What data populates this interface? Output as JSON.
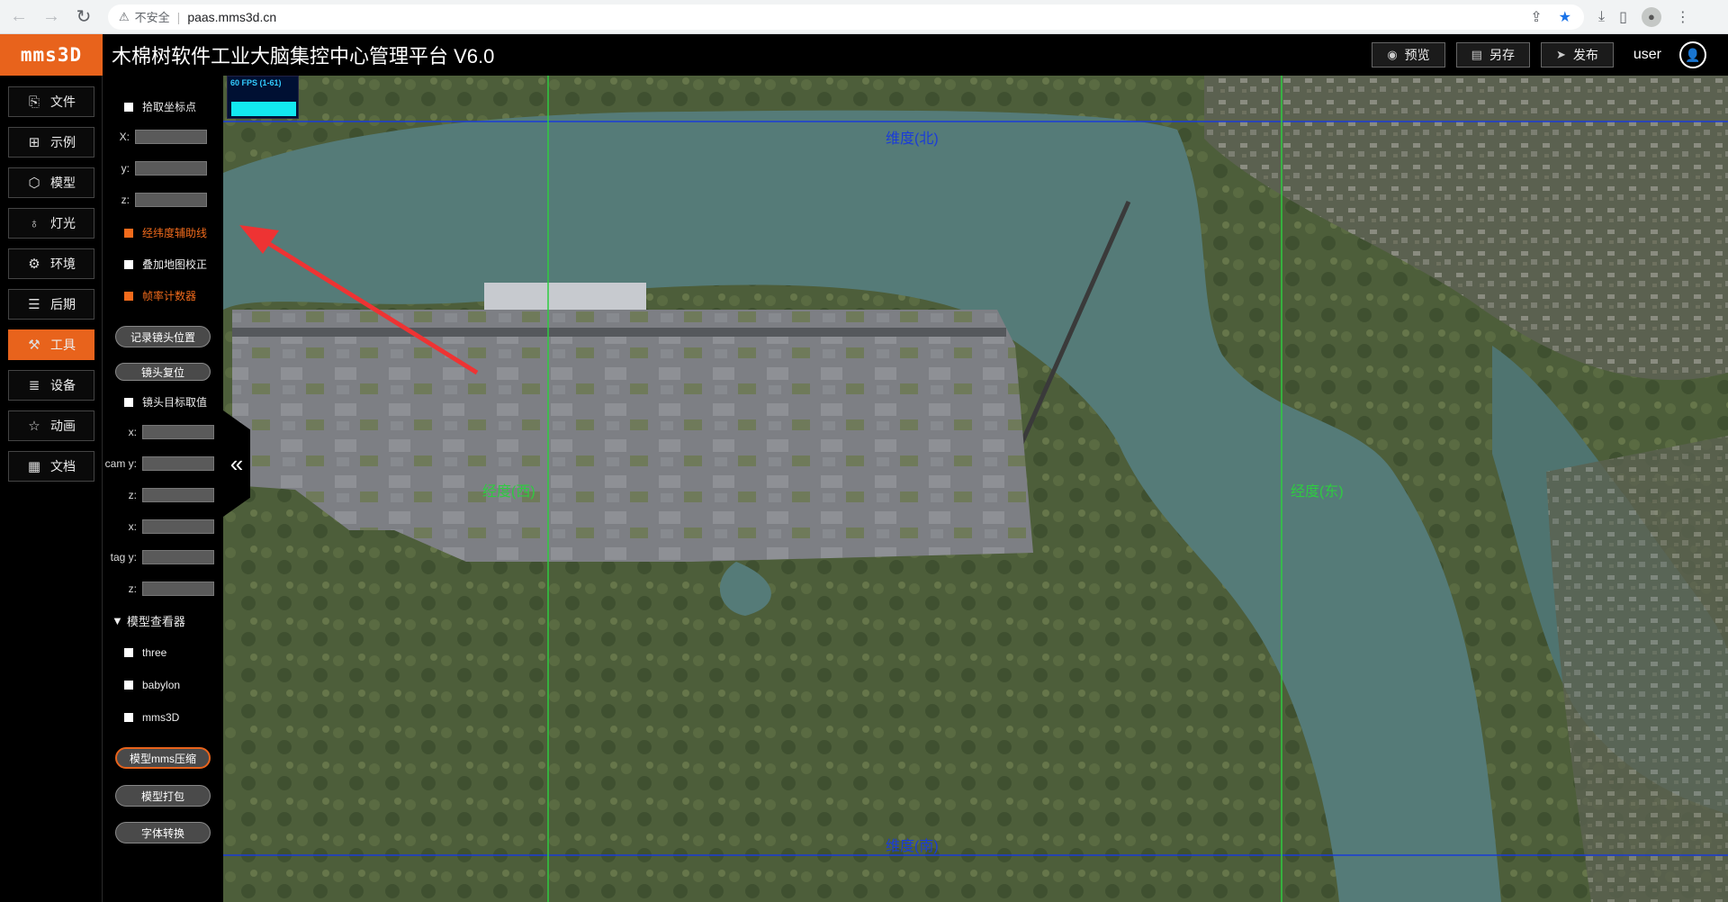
{
  "browser": {
    "security_label": "不安全",
    "url": "paas.mms3d.cn"
  },
  "header": {
    "logo": "mms3D",
    "title": "木棉树软件工业大脑集控中心管理平台 V6.0",
    "actions": [
      {
        "label": "预览",
        "icon": "eye-icon"
      },
      {
        "label": "另存",
        "icon": "save-icon"
      },
      {
        "label": "发布",
        "icon": "send-icon"
      }
    ],
    "user": "user"
  },
  "nav": {
    "items": [
      {
        "label": "文件",
        "icon": "folder-icon"
      },
      {
        "label": "示例",
        "icon": "grid-icon"
      },
      {
        "label": "模型",
        "icon": "cube-icon"
      },
      {
        "label": "灯光",
        "icon": "bulb-icon"
      },
      {
        "label": "环境",
        "icon": "gear-icon"
      },
      {
        "label": "后期",
        "icon": "layers-icon"
      },
      {
        "label": "工具",
        "icon": "wrench-icon",
        "active": true
      },
      {
        "label": "设备",
        "icon": "list-icon"
      },
      {
        "label": "动画",
        "icon": "star-icon"
      },
      {
        "label": "文档",
        "icon": "document-icon"
      }
    ]
  },
  "tools": {
    "pick_point": "拾取坐标点",
    "x_label": "X:",
    "y_label": "y:",
    "z_label": "z:",
    "latlng_guide": "经纬度辅助线",
    "map_overlay": "叠加地图校正",
    "fps_counter": "帧率计数器",
    "record_camera": "记录镜头位置",
    "reset_camera": "镜头复位",
    "camera_target": "镜头目标取值",
    "cam_x": "x:",
    "cam_y": "cam y:",
    "cam_z": "z:",
    "tag_x": "x:",
    "tag_y": "tag  y:",
    "tag_z": "z:",
    "viewer_title": "模型查看器",
    "viewer_three": "three",
    "viewer_babylon": "babylon",
    "viewer_mms3d": "mms3D",
    "compress": "模型mms压缩",
    "pack": "模型打包",
    "font_convert": "字体转换"
  },
  "viewport": {
    "fps_text": "60 FPS (1-61)",
    "lat_north": "维度(北)",
    "lat_south": "维度(南)",
    "lng_west": "经度(西)",
    "lng_east": "经度(东)",
    "collapse": "«"
  }
}
